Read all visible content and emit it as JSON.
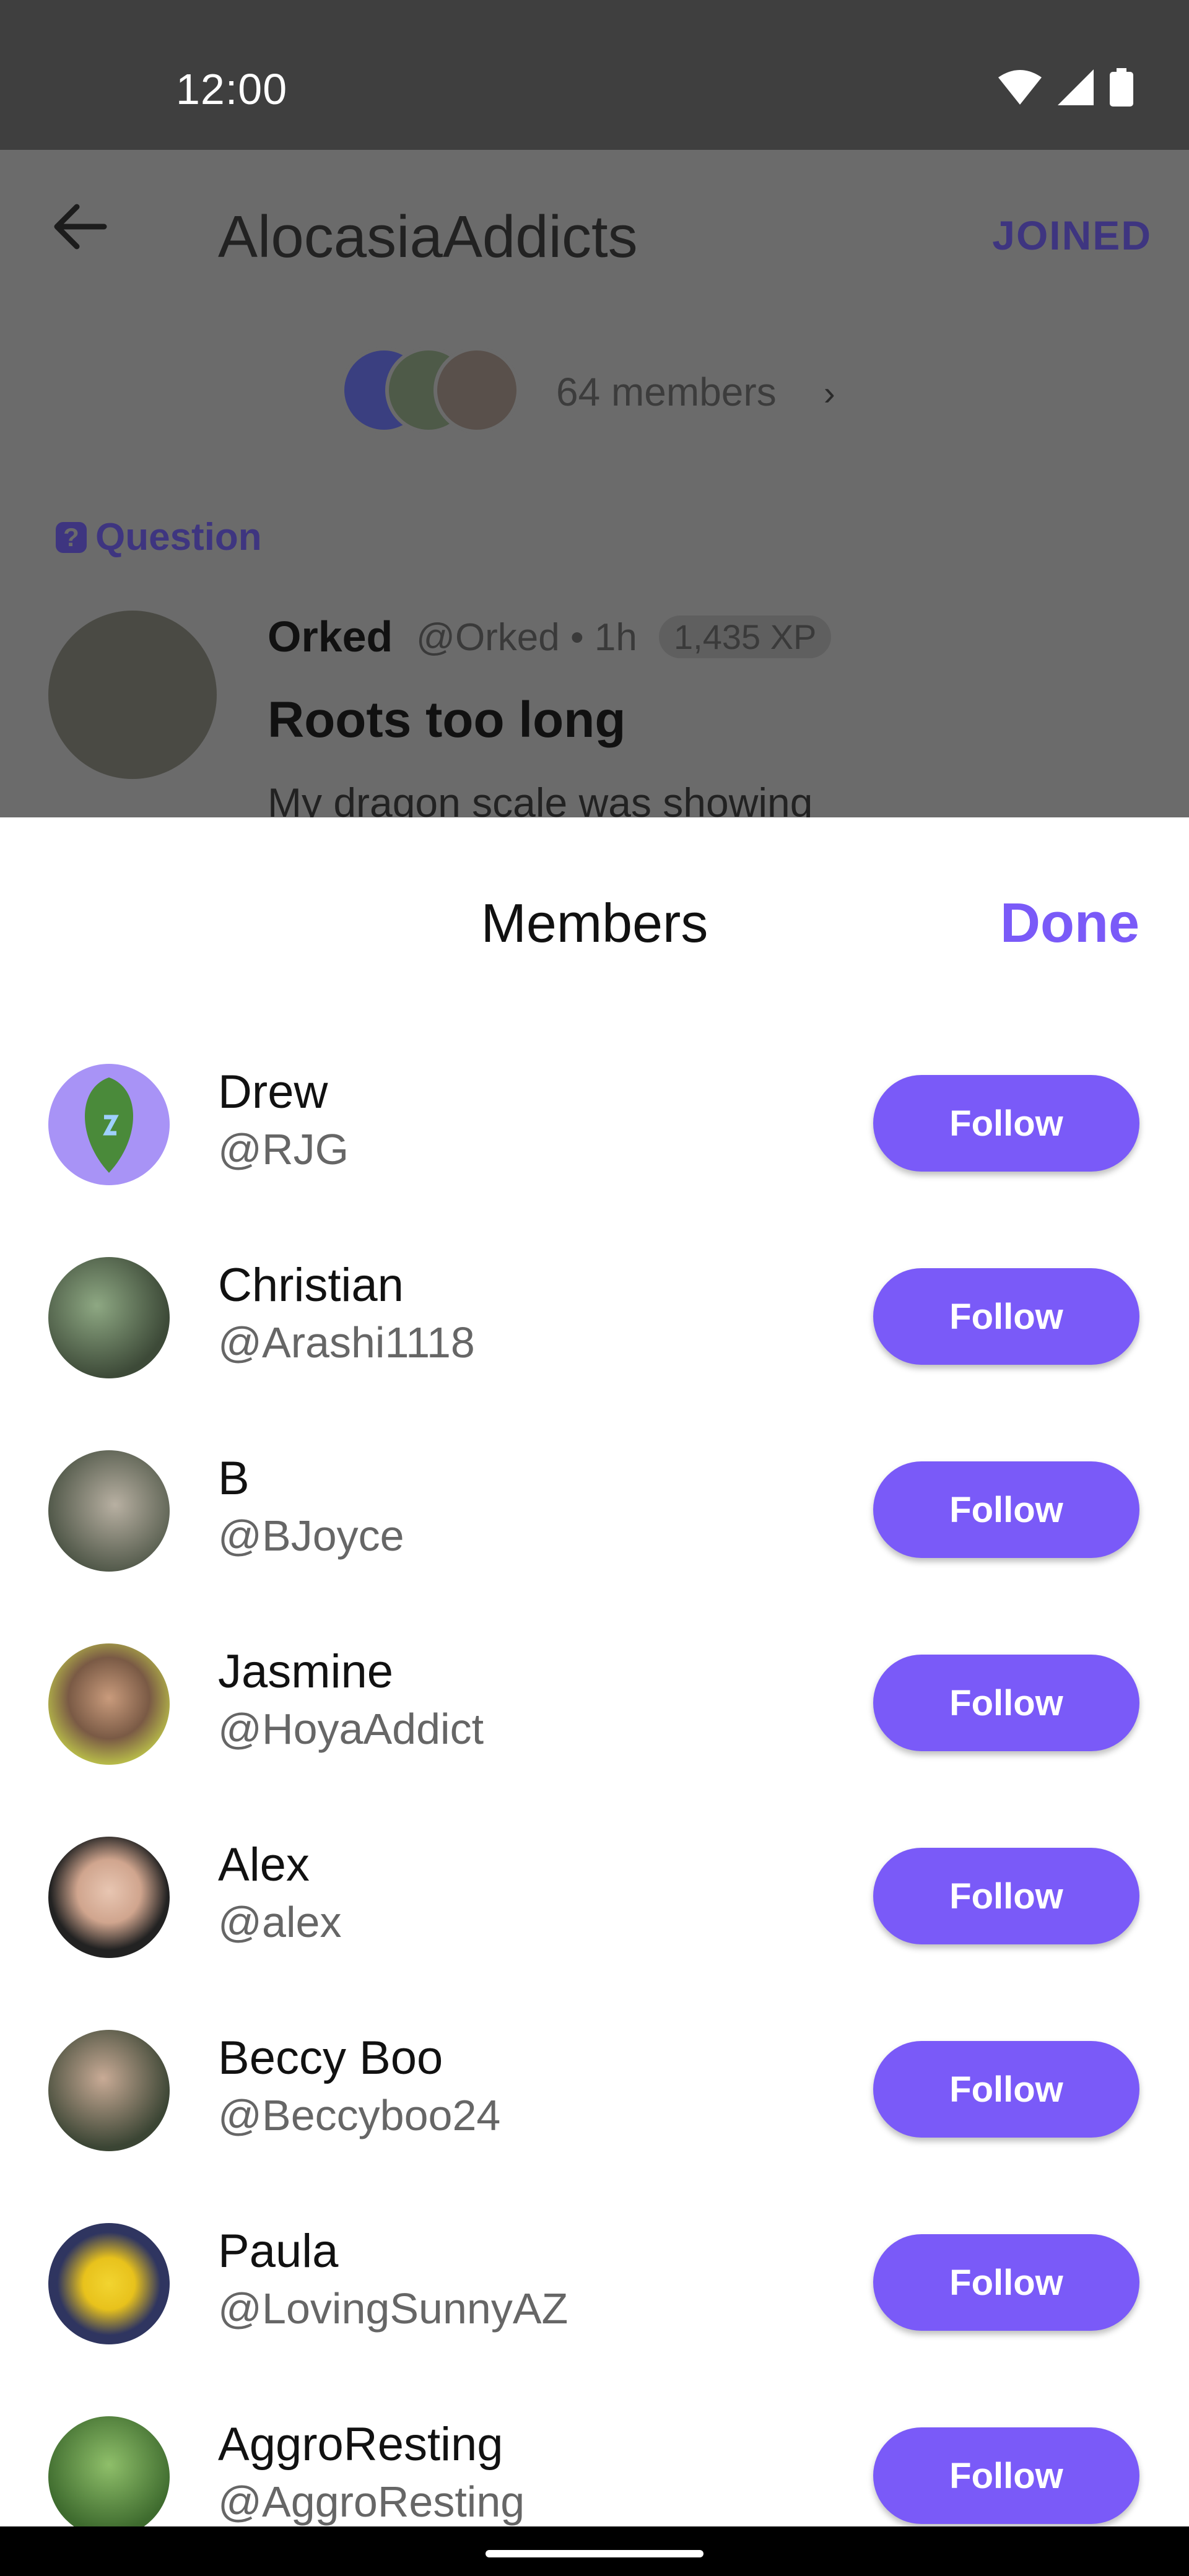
{
  "status_bar": {
    "time": "12:00",
    "icons": [
      "wifi-icon",
      "signal-icon",
      "battery-icon"
    ]
  },
  "background": {
    "group_title": "AlocasiaAddicts",
    "joined_label": "JOINED",
    "members_count": "64 members",
    "post": {
      "type_label": "Question",
      "author": "Orked",
      "meta": "@Orked • 1h",
      "xp": "1,435 XP",
      "title": "Roots too long",
      "body": "My dragon scale was showing"
    }
  },
  "sheet": {
    "title": "Members",
    "done_label": "Done",
    "members": [
      {
        "name": "Drew",
        "handle": "@RJG",
        "button": "Follow"
      },
      {
        "name": "Christian",
        "handle": "@Arashi1118",
        "button": "Follow"
      },
      {
        "name": "B",
        "handle": "@BJoyce",
        "button": "Follow"
      },
      {
        "name": "Jasmine",
        "handle": "@HoyaAddict",
        "button": "Follow"
      },
      {
        "name": "Alex",
        "handle": "@alex",
        "button": "Follow"
      },
      {
        "name": "Beccy Boo",
        "handle": "@Beccyboo24",
        "button": "Follow"
      },
      {
        "name": "Paula",
        "handle": "@LovingSunnyAZ",
        "button": "Follow"
      },
      {
        "name": "AggroResting",
        "handle": "@AggroResting",
        "button": "Follow"
      }
    ]
  },
  "colors": {
    "accent": "#7a5af8",
    "status_bar": "#3f3f3f",
    "scrim": "#6b6b6b"
  }
}
